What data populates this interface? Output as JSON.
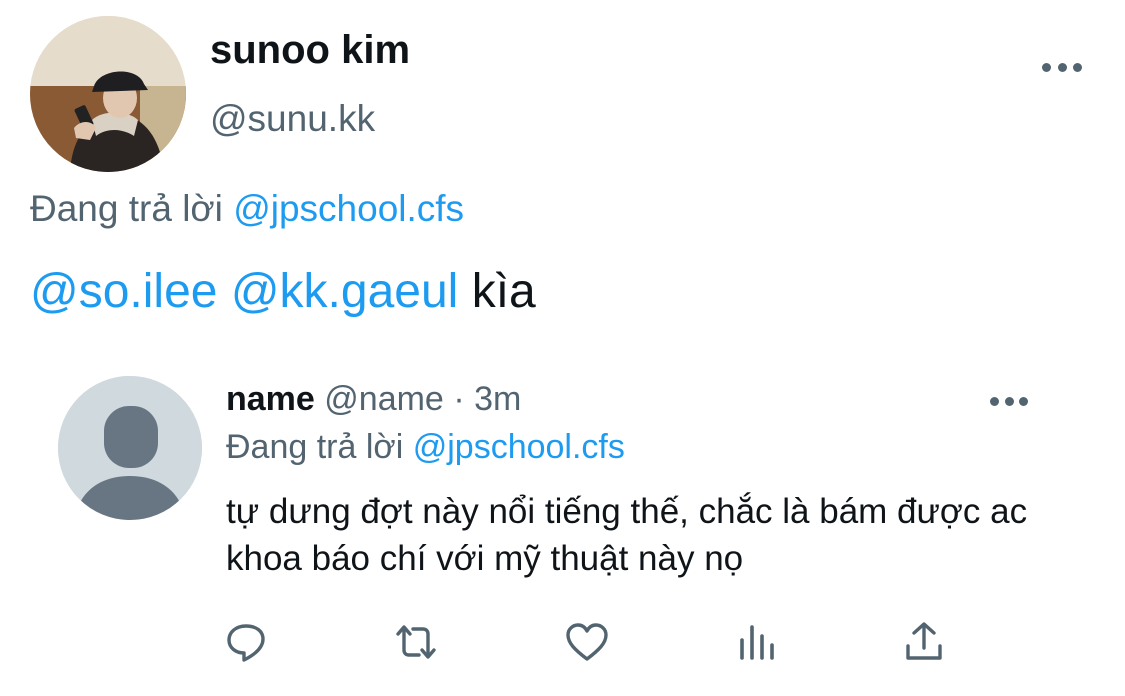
{
  "tweet": {
    "display_name": "sunoo kim",
    "handle": "@sunu.kk",
    "reply_prefix": "Đang trả lời",
    "reply_to": "@jpschool.cfs",
    "mention_1": "@so.ilee",
    "mention_2": "@kk.gaeul",
    "body": "kìa",
    "avatar_icon": "profile-photo"
  },
  "quoted": {
    "display_name": "name",
    "handle": "@name",
    "separator": "·",
    "time": "3m",
    "reply_prefix": "Đang trả lời",
    "reply_to": "@jpschool.cfs",
    "text": "tự dưng đợt này nổi tiếng thế, chắc là bám được ac khoa báo chí với mỹ thuật này nọ",
    "avatar_icon": "default-avatar"
  },
  "actions": [
    {
      "name": "reply-icon"
    },
    {
      "name": "retweet-icon"
    },
    {
      "name": "like-icon"
    },
    {
      "name": "analytics-icon"
    },
    {
      "name": "share-icon"
    }
  ],
  "colors": {
    "link": "#1d9bf0",
    "secondary": "#536471",
    "text": "#0f1419",
    "avatar_placeholder": "#cfd9de",
    "avatar_silhouette": "#687684"
  }
}
